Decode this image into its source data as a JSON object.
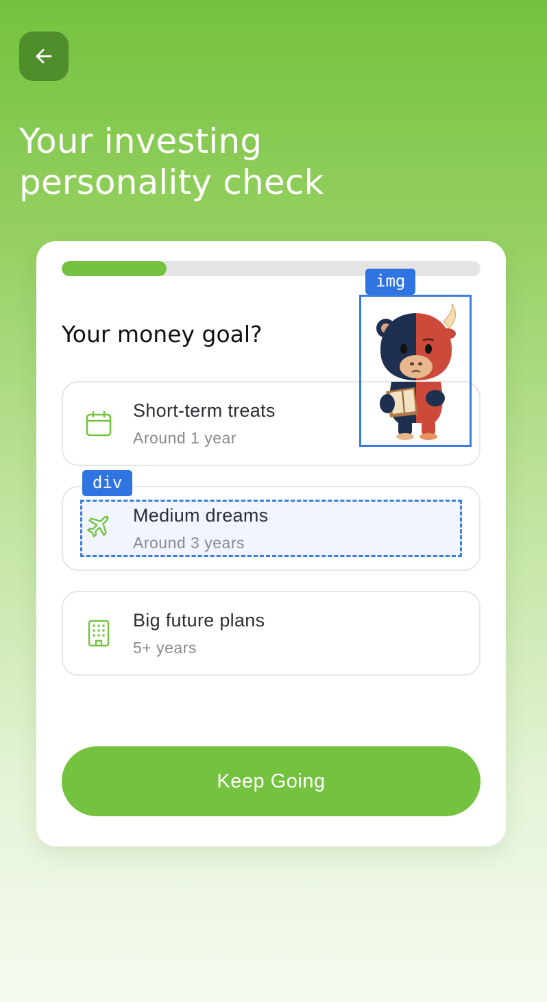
{
  "header": {
    "back_icon": "arrow-left-icon",
    "title_line1": "Your investing",
    "title_line2": "personality check"
  },
  "quiz": {
    "progress_percent": 25,
    "question": "Your money goal?",
    "options": [
      {
        "icon": "calendar-icon",
        "title": "Short-term treats",
        "subtitle": "Around 1 year"
      },
      {
        "icon": "airplane-icon",
        "title": "Medium dreams",
        "subtitle": "Around 3 years"
      },
      {
        "icon": "building-icon",
        "title": "Big future plans",
        "subtitle": "5+ years"
      }
    ],
    "cta_label": "Keep Going"
  },
  "annotations": {
    "img_tag": "img",
    "div_tag": "div"
  },
  "colors": {
    "brand_green": "#74c23f",
    "back_button": "#4f8e2b",
    "annotation_blue": "#2f74e0"
  }
}
